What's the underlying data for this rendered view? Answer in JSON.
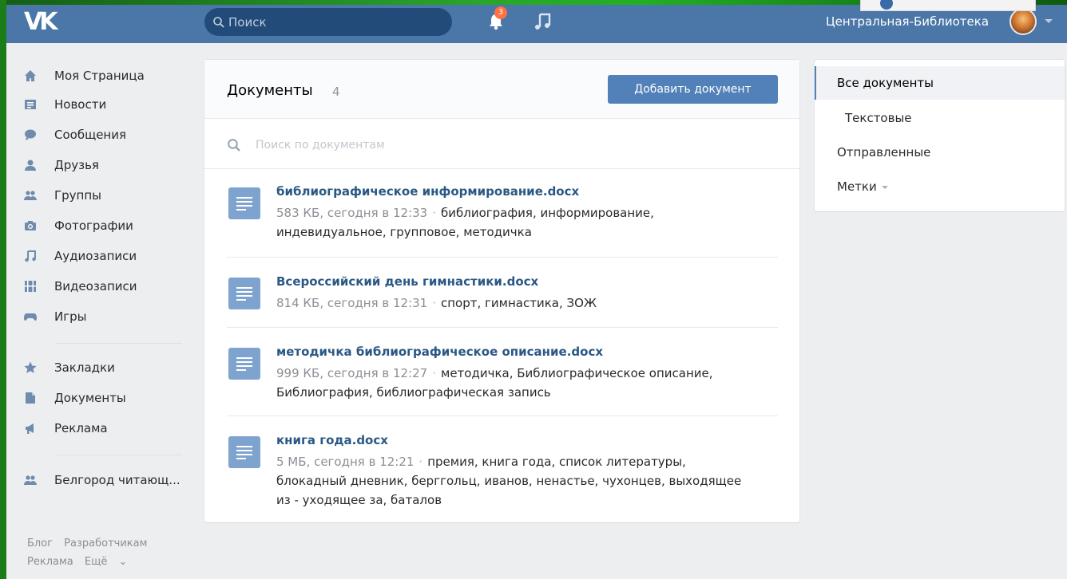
{
  "header": {
    "logo": "VK",
    "search_placeholder": "Поиск",
    "notification_count": "3",
    "user_name": "Центральная-Библиотека"
  },
  "sidebar": {
    "items": [
      {
        "label": "Моя Страница",
        "icon": "home-icon"
      },
      {
        "label": "Новости",
        "icon": "news-icon"
      },
      {
        "label": "Сообщения",
        "icon": "messages-icon"
      },
      {
        "label": "Друзья",
        "icon": "friend-icon"
      },
      {
        "label": "Группы",
        "icon": "groups-icon"
      },
      {
        "label": "Фотографии",
        "icon": "camera-icon"
      },
      {
        "label": "Аудиозаписи",
        "icon": "music-icon"
      },
      {
        "label": "Видеозаписи",
        "icon": "film-icon"
      },
      {
        "label": "Игры",
        "icon": "gamepad-icon"
      }
    ],
    "items2": [
      {
        "label": "Закладки",
        "icon": "star-icon"
      },
      {
        "label": "Документы",
        "icon": "document-icon"
      },
      {
        "label": "Реклама",
        "icon": "megaphone-icon"
      }
    ],
    "items3": [
      {
        "label": "Белгород читающ...",
        "icon": "groups-icon"
      }
    ],
    "footer": [
      "Блог",
      "Разработчикам",
      "Реклама",
      "Ещё"
    ]
  },
  "main": {
    "title": "Документы",
    "count": "4",
    "add_button": "Добавить документ",
    "search_placeholder": "Поиск по документам",
    "docs": [
      {
        "title": "библиографическое информирование.docx",
        "meta": "583 КБ, сегодня в 12:33",
        "tags": "библиография, информирование, индевидуальное, групповое, методичка"
      },
      {
        "title": "Всероссийский день гимнастики.docx",
        "meta": "814 КБ, сегодня в 12:31",
        "tags": "спорт, гимнастика, ЗОЖ"
      },
      {
        "title": "методичка библиографическое описание.docx",
        "meta": "999 КБ, сегодня в 12:27",
        "tags": "методичка, Библиографическое описание, Библиография, библиографическая запись"
      },
      {
        "title": "книга года.docx",
        "meta": "5 МБ, сегодня в 12:21",
        "tags": "премия, книга года, список литературы, блокадный дневник, берггольц, иванов, ненастье, чухонцев, выходящее из - уходящее за, баталов"
      }
    ]
  },
  "rmenu": {
    "all": "Все документы",
    "text": "Текстовые",
    "sent": "Отправленные",
    "tags": "Метки"
  },
  "colors": {
    "header": "#4a76a8",
    "accent": "#5181b8",
    "link": "#2a5885",
    "frame": "#1a7d1a"
  }
}
